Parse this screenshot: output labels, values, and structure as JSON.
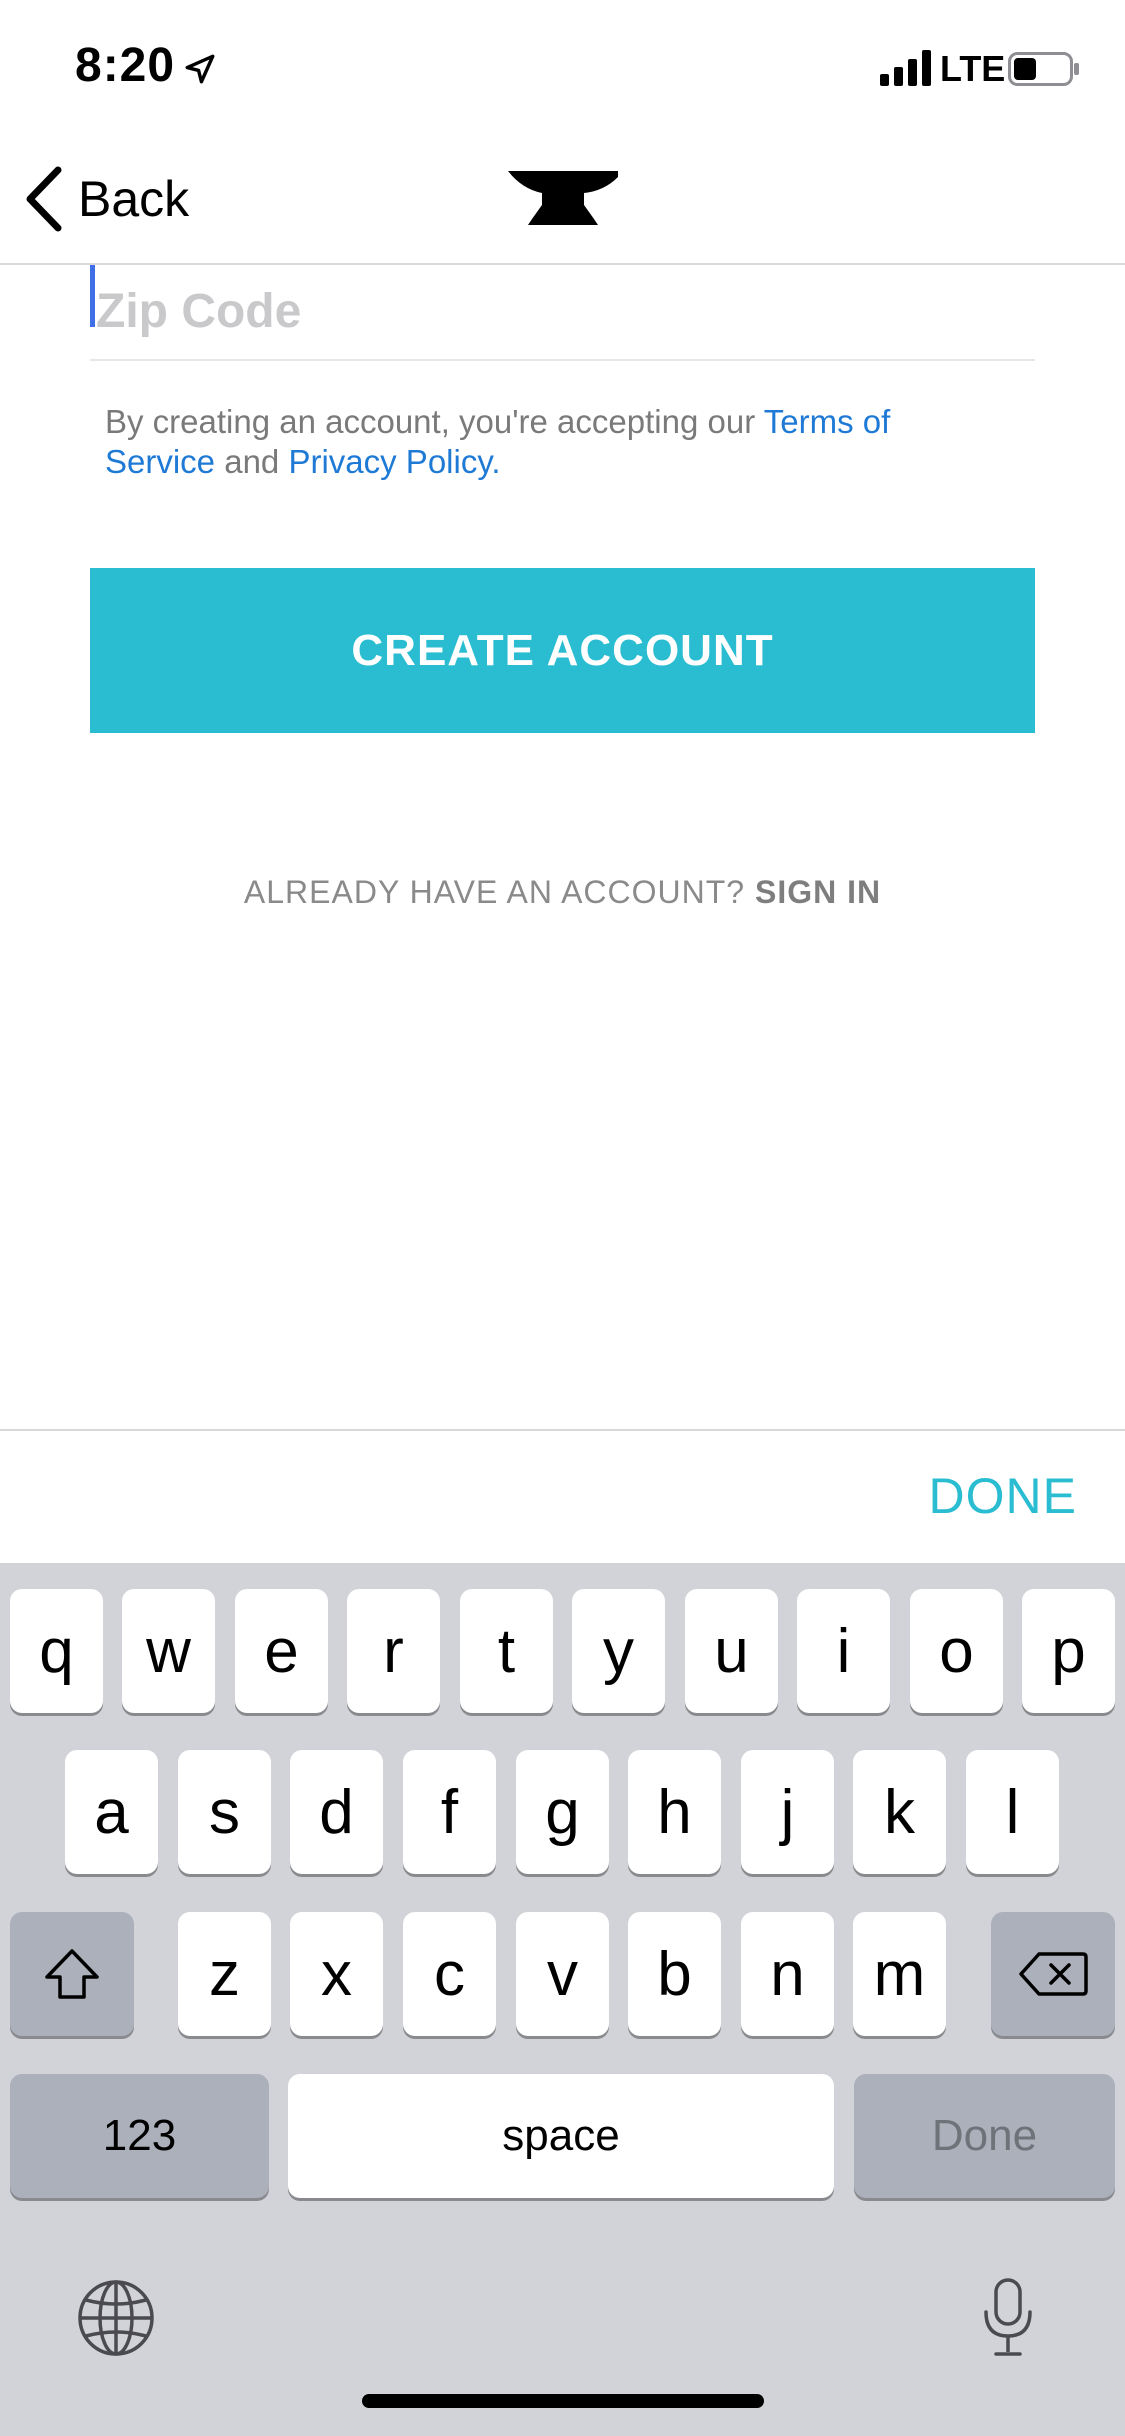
{
  "status_bar": {
    "time": "8:20",
    "network": "LTE",
    "icons": [
      "location-arrow-icon",
      "signal-bars-icon",
      "battery-icon"
    ]
  },
  "nav": {
    "back_label": "Back",
    "logo": "anvil-logo-icon"
  },
  "form": {
    "zip_placeholder": "Zip Code",
    "zip_value": "",
    "terms": {
      "prefix": "By creating an account, you're accepting our ",
      "terms_link": "Terms of Service",
      "middle": " and ",
      "privacy_link": "Privacy Policy",
      "suffix": "."
    },
    "create_button": "CREATE ACCOUNT",
    "signin_prompt": "ALREADY HAVE AN ACCOUNT? ",
    "signin_link": "SIGN IN"
  },
  "accessory": {
    "done": "DONE"
  },
  "keyboard": {
    "row1": [
      "q",
      "w",
      "e",
      "r",
      "t",
      "y",
      "u",
      "i",
      "o",
      "p"
    ],
    "row2": [
      "a",
      "s",
      "d",
      "f",
      "g",
      "h",
      "j",
      "k",
      "l"
    ],
    "row3": [
      "z",
      "x",
      "c",
      "v",
      "b",
      "n",
      "m"
    ],
    "numbers_key": "123",
    "space_key": "space",
    "return_key": "Done",
    "icons": [
      "shift-icon",
      "backspace-icon",
      "globe-icon",
      "microphone-icon"
    ]
  },
  "colors": {
    "accent": "#2abdd1",
    "link": "#1f7ad6",
    "keyboard_bg": "#d1d3d9"
  }
}
